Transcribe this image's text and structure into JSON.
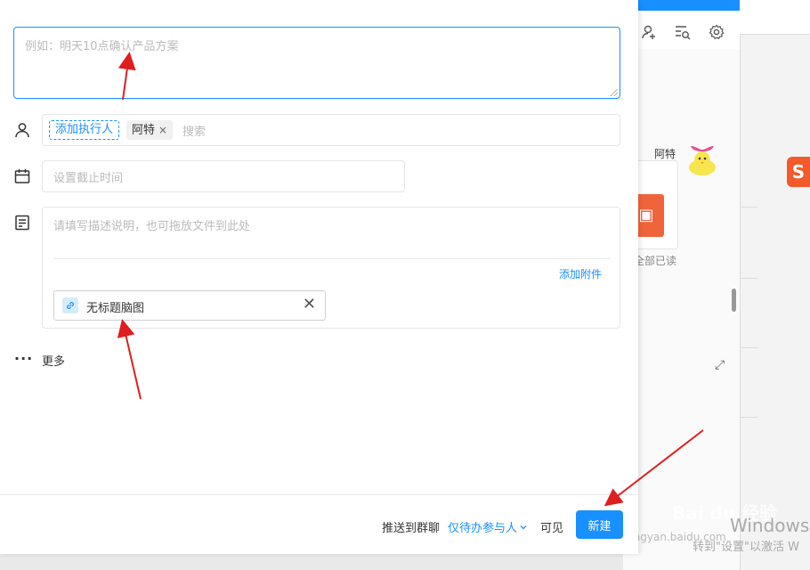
{
  "dialog": {
    "title_placeholder": "例如：明天10点确认产品方案",
    "assignee": {
      "add_label": "添加执行人",
      "tag_name": "阿特",
      "tag_remove": "×",
      "search_placeholder": "搜索"
    },
    "deadline_placeholder": "设置截止时间",
    "description": {
      "placeholder": "请填写描述说明，也可拖放文件到此处",
      "add_attachment": "添加附件",
      "attachment_name": "无标题脑图",
      "attachment_remove": "✕"
    },
    "more_label": "更多",
    "footer": {
      "push_label": "推送到群聊",
      "scope_select": "仅待办参与人",
      "visible_label": "可见",
      "create_button": "新建"
    }
  },
  "background": {
    "contact_name": "阿特",
    "read_all": "全部已读",
    "watermark": "Bai du 经验",
    "watermark_url": "jingyan.baidu.com",
    "windows_text": "Windows",
    "windows_sub": "转到\"设置\"以激活 W"
  },
  "icons": {
    "assignee": "person-icon",
    "deadline": "calendar-icon",
    "description": "document-icon",
    "more": "more-dots-icon",
    "attachment": "link-icon"
  },
  "colors": {
    "accent": "#1890ff",
    "arrow": "#e01e1e"
  }
}
